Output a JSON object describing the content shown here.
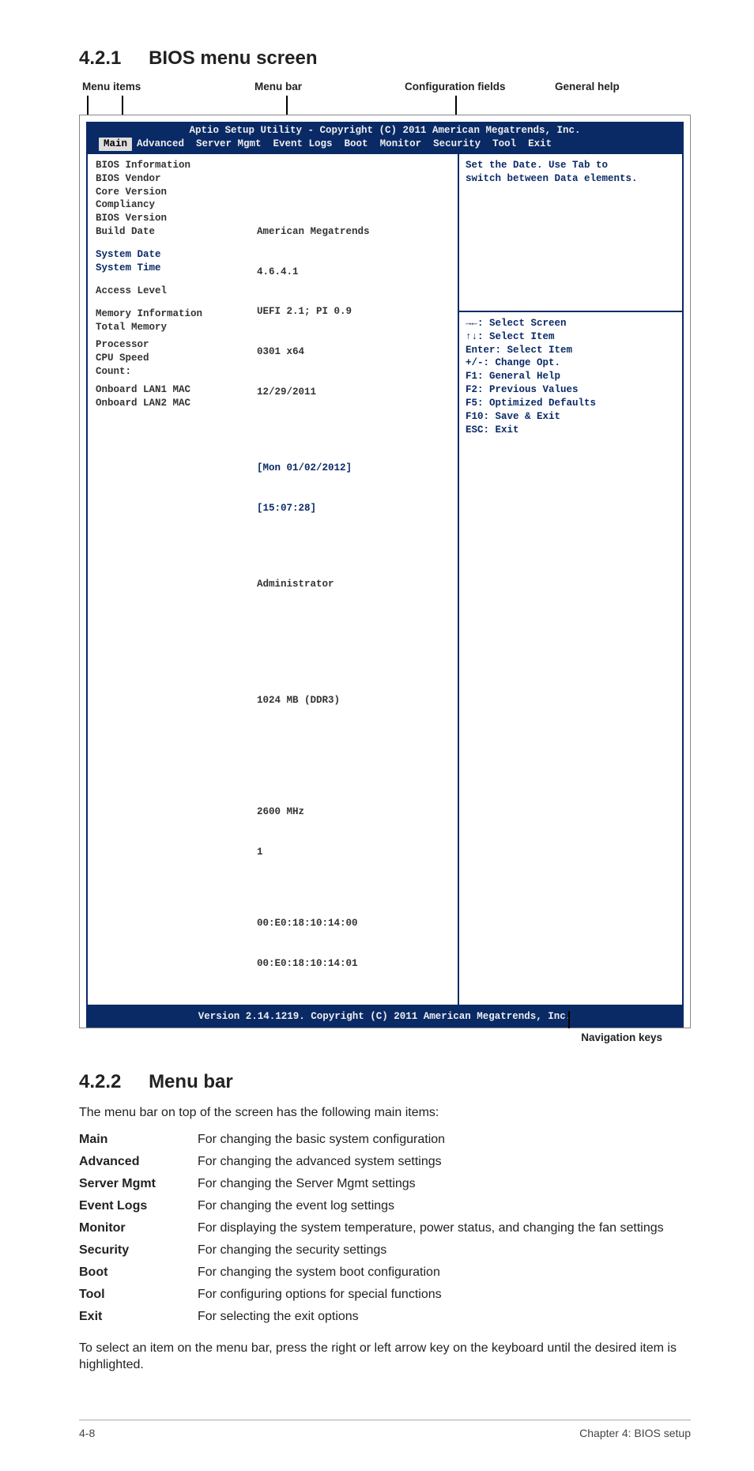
{
  "section1": {
    "number": "4.2.1",
    "title": "BIOS menu screen"
  },
  "diagram_labels": {
    "menu_items": "Menu items",
    "menu_bar": "Menu bar",
    "config_fields": "Configuration fields",
    "general_help": "General help",
    "nav_keys": "Navigation keys"
  },
  "bios": {
    "header_line1": "Aptio Setup Utility - Copyright (C) 2011 American Megatrends, Inc.",
    "menu": {
      "main_label": "Main",
      "rest": "Advanced  Server Mgmt  Event Logs  Boot  Monitor  Security  Tool  Exit"
    },
    "left": {
      "bios_information": "BIOS Information",
      "bios_vendor": "BIOS Vendor",
      "core_version": "Core Version",
      "compliancy": "Compliancy",
      "bios_version": "BIOS Version",
      "build_date": "Build Date",
      "system_date": "System Date",
      "system_time": "System Time",
      "access_level": "Access Level",
      "mem_info": "Memory Information",
      "total_memory": "Total Memory",
      "processor": "Processor",
      "cpu_speed": "CPU Speed",
      "count": "Count:",
      "lan1": "Onboard LAN1 MAC",
      "lan2": "Onboard LAN2 MAC"
    },
    "mid": {
      "vendor": "American Megatrends",
      "core": "4.6.4.1",
      "compl": "UEFI 2.1; PI 0.9",
      "ver": "0301 x64",
      "build": "12/29/2011",
      "date": "[Mon 01/02/2012]",
      "time": "[15:07:28]",
      "access": "Administrator",
      "mem": "1024 MB (DDR3)",
      "cpu": "2600 MHz",
      "count": "1",
      "mac1": "00:E0:18:10:14:00",
      "mac2": "00:E0:18:10:14:01"
    },
    "help_top_line1": "Set the Date. Use Tab to",
    "help_top_line2": "switch between Data elements.",
    "nav": {
      "l1": "→←: Select Screen",
      "l2": "↑↓:  Select Item",
      "l3": "Enter: Select Item",
      "l4": "+/-: Change Opt.",
      "l5": "F1: General Help",
      "l6": "F2: Previous Values",
      "l7": "F5: Optimized Defaults",
      "l8": "F10: Save & Exit",
      "l9": "ESC: Exit"
    },
    "footer": "Version 2.14.1219. Copyright (C) 2011 American Megatrends, Inc."
  },
  "section2": {
    "number": "4.2.2",
    "title": "Menu bar"
  },
  "section2_intro": "The menu bar on top of the screen has the following main items:",
  "items": {
    "main": {
      "t": "Main",
      "d": "For changing the basic system configuration"
    },
    "advanced": {
      "t": "Advanced",
      "d": "For changing the advanced system settings"
    },
    "server": {
      "t": "Server Mgmt",
      "d": "For changing the Server Mgmt settings"
    },
    "eventlogs": {
      "t": "Event Logs",
      "d": "For changing the event log settings"
    },
    "monitor": {
      "t": "Monitor",
      "d": "For displaying the system temperature, power status, and changing the fan settings"
    },
    "security": {
      "t": "Security",
      "d": "For changing the security settings"
    },
    "boot": {
      "t": "Boot",
      "d": "For changing the system boot configuration"
    },
    "tool": {
      "t": "Tool",
      "d": "For configuring options for special functions"
    },
    "exit": {
      "t": "Exit",
      "d": "For selecting the exit options"
    }
  },
  "section2_outro": "To select an item on the menu bar, press the right or left arrow key on the keyboard until the desired item is highlighted.",
  "footer": {
    "left": "4-8",
    "right": "Chapter 4: BIOS setup"
  }
}
